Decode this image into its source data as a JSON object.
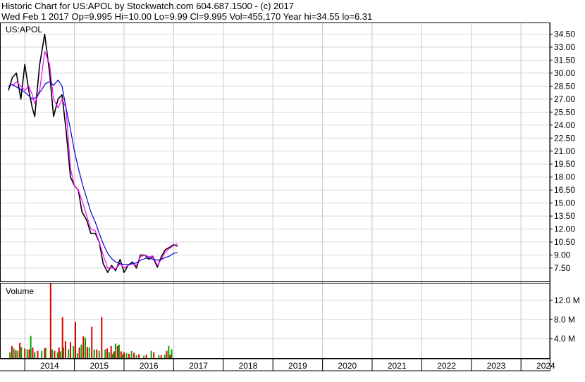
{
  "header": {
    "line1": "Historic Chart for US:APOL by Stockwatch.com 604.687.1500 - (c) 2017",
    "line2": "Wed Feb  1 2017   Op=9.995  Hi=10.00  Lo=9.99  Cl=9.995  Vol=455,170  Year hi=34.55  lo=6.31"
  },
  "colors": {
    "price": "#000000",
    "ma_short": "#ff00ff",
    "ma_long": "#0000cc",
    "volume_up": "#00aa00",
    "volume_down": "#dd0000",
    "grid": "#d8d8d8",
    "background": "#ffffff"
  },
  "chart_data": [
    {
      "type": "line",
      "title": "US:APOL",
      "ylim": [
        6.31,
        35.5
      ],
      "y_ticks": [
        "34.50",
        "33.00",
        "31.50",
        "30.00",
        "28.50",
        "27.00",
        "25.50",
        "24.00",
        "22.50",
        "21.00",
        "19.50",
        "18.00",
        "16.50",
        "15.00",
        "13.50",
        "12.00",
        "10.50",
        "9.00",
        "7.50"
      ],
      "x_ticks": [
        "2014",
        "2015",
        "2016",
        "2017",
        "2018",
        "2019",
        "2020",
        "2021",
        "2022",
        "2023",
        "2024"
      ],
      "grid": true,
      "series": [
        {
          "key": "price",
          "x": [
            2013.67,
            2013.75,
            2013.83,
            2013.92,
            2014.0,
            2014.08,
            2014.15,
            2014.2,
            2014.3,
            2014.4,
            2014.5,
            2014.58,
            2014.67,
            2014.75,
            2014.83,
            2014.92,
            2015.0,
            2015.08,
            2015.15,
            2015.25,
            2015.33,
            2015.42,
            2015.5,
            2015.58,
            2015.67,
            2015.75,
            2015.83,
            2015.92,
            2016.0,
            2016.08,
            2016.17,
            2016.25,
            2016.33,
            2016.42,
            2016.5,
            2016.58,
            2016.67,
            2016.75,
            2016.83,
            2016.92,
            2017.0,
            2017.08
          ],
          "values": [
            28,
            29.5,
            30,
            27,
            31,
            28,
            26,
            25,
            31,
            34.5,
            30,
            25,
            27,
            27.5,
            23.5,
            18,
            17,
            16.5,
            14,
            13,
            11.5,
            11.5,
            10.5,
            8,
            7,
            7.8,
            7.2,
            8.5,
            7,
            7.8,
            8.2,
            7.5,
            9,
            9,
            8.5,
            8.8,
            7.6,
            8.8,
            9.6,
            9.9,
            10.2,
            10
          ]
        },
        {
          "key": "ma_short",
          "x": [
            2013.75,
            2013.83,
            2013.92,
            2014.0,
            2014.08,
            2014.15,
            2014.2,
            2014.3,
            2014.4,
            2014.5,
            2014.58,
            2014.67,
            2014.75,
            2014.83,
            2014.92,
            2015.0,
            2015.08,
            2015.17,
            2015.25,
            2015.33,
            2015.42,
            2015.5,
            2015.58,
            2015.67,
            2015.75,
            2015.83,
            2015.92,
            2016.0,
            2016.08,
            2016.17,
            2016.25,
            2016.33,
            2016.42,
            2016.5,
            2016.58,
            2016.67,
            2016.75,
            2016.83,
            2016.92,
            2017.0,
            2017.08
          ],
          "values": [
            28.5,
            29,
            28.5,
            28,
            28.5,
            27.5,
            26.5,
            28,
            32.5,
            31,
            27,
            26,
            27,
            26,
            19,
            17,
            16.5,
            15,
            13.5,
            12,
            11.8,
            10.5,
            9,
            7.5,
            7.5,
            7.4,
            8,
            7.5,
            7.8,
            8,
            7.8,
            8.8,
            9,
            8.8,
            8.9,
            7.8,
            8.5,
            9.3,
            9.8,
            10.1,
            10.3
          ]
        },
        {
          "key": "ma_long",
          "x": [
            2013.67,
            2013.75,
            2013.83,
            2013.92,
            2014.0,
            2014.08,
            2014.15,
            2014.23,
            2014.33,
            2014.42,
            2014.5,
            2014.58,
            2014.67,
            2014.75,
            2014.83,
            2014.92,
            2015.0,
            2015.08,
            2015.17,
            2015.25,
            2015.33,
            2015.42,
            2015.5,
            2015.58,
            2015.67,
            2015.75,
            2015.83,
            2015.92,
            2016.0,
            2016.08,
            2016.17,
            2016.25,
            2016.33,
            2016.42,
            2016.5,
            2016.58,
            2016.67,
            2016.75,
            2016.83,
            2016.92,
            2017.0,
            2017.08
          ],
          "values": [
            28.5,
            28.7,
            28.4,
            28.1,
            27.8,
            27.4,
            27.0,
            27.2,
            28.0,
            28.8,
            29.0,
            28.6,
            29.2,
            28.5,
            26,
            23.5,
            21,
            19,
            17,
            15.5,
            14,
            12.8,
            11.5,
            10.3,
            9.2,
            8.6,
            8.2,
            8.0,
            7.9,
            7.9,
            8.0,
            8.1,
            8.4,
            8.6,
            8.7,
            8.5,
            8.4,
            8.5,
            8.7,
            8.9,
            9.2,
            9.3
          ]
        }
      ]
    },
    {
      "type": "bar",
      "title": "Volume",
      "ylim": [
        0,
        15.5
      ],
      "y_unit": "M",
      "y_ticks": [
        "12.0 M",
        "8.0 M",
        "4.0 M"
      ],
      "series": [
        {
          "key": "volume_up",
          "x": [
            2013.7,
            2013.78,
            2013.86,
            2013.93,
            2014.05,
            2014.12,
            2014.2,
            2014.34,
            2014.42,
            2014.55,
            2014.66,
            2014.72,
            2014.78,
            2014.88,
            2014.98,
            2015.06,
            2015.14,
            2015.22,
            2015.3,
            2015.4,
            2015.5,
            2015.62,
            2015.7,
            2015.77,
            2015.83,
            2015.9,
            2015.97,
            2016.05,
            2016.15,
            2016.25,
            2016.4,
            2016.55,
            2016.7,
            2016.82,
            2016.9,
            2016.96
          ],
          "values": [
            1.2,
            2.0,
            1.5,
            2.3,
            1.8,
            4.6,
            1.2,
            1.5,
            2.1,
            1.8,
            1.2,
            1.4,
            2.2,
            1.8,
            2.5,
            1.0,
            2.8,
            4.2,
            2.2,
            1.8,
            1.5,
            1.8,
            1.2,
            0.9,
            3.0,
            2.8,
            0.8,
            1.0,
            1.5,
            0.6,
            0.5,
            1.5,
            0.6,
            0.7,
            2.5,
            1.8
          ]
        },
        {
          "key": "volume_down",
          "x": [
            2013.74,
            2013.82,
            2013.9,
            2014.0,
            2014.09,
            2014.16,
            2014.26,
            2014.4,
            2014.52,
            2014.6,
            2014.69,
            2014.76,
            2014.82,
            2014.92,
            2015.02,
            2015.1,
            2015.18,
            2015.26,
            2015.35,
            2015.45,
            2015.55,
            2015.66,
            2015.74,
            2015.8,
            2015.87,
            2015.94,
            2016.0,
            2016.1,
            2016.2,
            2016.3,
            2016.45,
            2016.6,
            2016.75,
            2016.86,
            2016.93
          ],
          "values": [
            2.5,
            1.6,
            3.2,
            2.0,
            1.8,
            2.2,
            1.5,
            2.0,
            15.5,
            1.5,
            2.2,
            8.5,
            3.5,
            3.3,
            7.5,
            2.2,
            4.5,
            2.3,
            6.5,
            1.8,
            8.5,
            2.0,
            2.5,
            1.4,
            2.5,
            1.4,
            1.2,
            0.9,
            1.1,
            0.8,
            0.7,
            1.2,
            0.6,
            1.5,
            0.7
          ]
        }
      ]
    }
  ]
}
